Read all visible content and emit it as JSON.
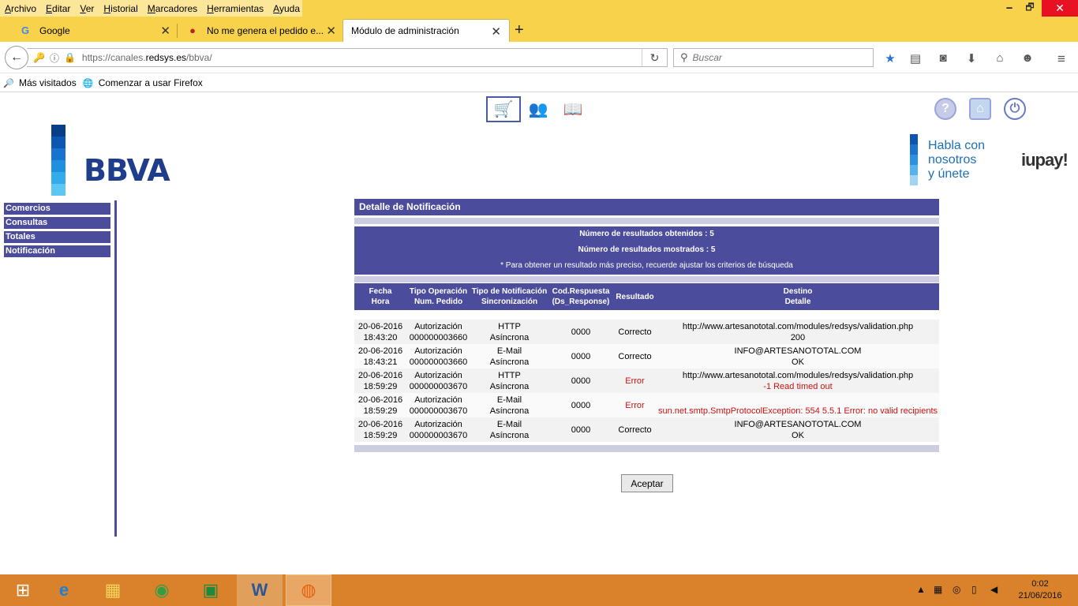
{
  "menubar": {
    "items": [
      "Archivo",
      "Editar",
      "Ver",
      "Historial",
      "Marcadores",
      "Herramientas",
      "Ayuda"
    ],
    "minimize": "🗕",
    "maximize": "🗗",
    "close": "✕"
  },
  "tabs": [
    {
      "title": "Google",
      "icon": "G"
    },
    {
      "title": "No me genera el pedido e...",
      "icon": "●"
    },
    {
      "title": "Módulo de administración",
      "icon": ""
    }
  ],
  "tab_close": "✕",
  "new_tab": "+",
  "nav": {
    "back": "←",
    "url_prefix": "https://canales.",
    "url_domain": "redsys.es",
    "url_path": "/bbva/",
    "reload": "↻",
    "search_placeholder": "Buscar"
  },
  "bookmarks": [
    {
      "label": "Más visitados"
    },
    {
      "label": "Comenzar a usar Firefox"
    }
  ],
  "page": {
    "brand": "BBVA",
    "promo": [
      "Habla con",
      "nosotros",
      "y únete"
    ],
    "promo_brand": "iupay!",
    "left_menu": [
      "Comercios",
      "Consultas",
      "Totales",
      "Notificación"
    ],
    "panel_title": "Detalle de Notificación",
    "results_obtained": "Número de resultados obtenidos : 5",
    "results_shown": "Número de resultados mostrados : 5",
    "note": "* Para obtener un resultado más preciso, recuerde ajustar los criterios de búsqueda",
    "columns": [
      [
        "Fecha",
        "Hora"
      ],
      [
        "Tipo Operación",
        "Num. Pedido"
      ],
      [
        "Tipo de Notificación",
        "Sincronización"
      ],
      [
        "Cod.Respuesta",
        "(Ds_Response)"
      ],
      [
        "Resultado",
        ""
      ],
      [
        "Destino",
        "Detalle"
      ]
    ],
    "rows": [
      {
        "fecha": "20-06-2016",
        "hora": "18:43:20",
        "tipo": "Autorización",
        "pedido": "000000003660",
        "notif": "HTTP",
        "sync": "Asíncrona",
        "cod": "0000",
        "resultado": "Correcto",
        "destino": "http://www.artesanototal.com/modules/redsys/validation.php",
        "detalle": "200",
        "error": false
      },
      {
        "fecha": "20-06-2016",
        "hora": "18:43:21",
        "tipo": "Autorización",
        "pedido": "000000003660",
        "notif": "E-Mail",
        "sync": "Asíncrona",
        "cod": "0000",
        "resultado": "Correcto",
        "destino": "INFO@ARTESANOTOTAL.COM",
        "detalle": "OK",
        "error": false
      },
      {
        "fecha": "20-06-2016",
        "hora": "18:59:29",
        "tipo": "Autorización",
        "pedido": "000000003670",
        "notif": "HTTP",
        "sync": "Asíncrona",
        "cod": "0000",
        "resultado": "Error",
        "destino": "http://www.artesanototal.com/modules/redsys/validation.php",
        "detalle": "-1 Read timed out",
        "error": true
      },
      {
        "fecha": "20-06-2016",
        "hora": "18:59:29",
        "tipo": "Autorización",
        "pedido": "000000003670",
        "notif": "E-Mail",
        "sync": "Asíncrona",
        "cod": "0000",
        "resultado": "Error",
        "destino": "",
        "detalle": "sun.net.smtp.SmtpProtocolException: 554 5.5.1 Error: no valid recipients",
        "error": true
      },
      {
        "fecha": "20-06-2016",
        "hora": "18:59:29",
        "tipo": "Autorización",
        "pedido": "000000003670",
        "notif": "E-Mail",
        "sync": "Asíncrona",
        "cod": "0000",
        "resultado": "Correcto",
        "destino": "INFO@ARTESANOTOTAL.COM",
        "detalle": "OK",
        "error": false
      }
    ],
    "accept_label": "Aceptar"
  },
  "taskbar": {
    "time": "0:02",
    "date": "21/06/2016"
  },
  "colors": {
    "menubar": "#f7d24a",
    "panel": "#4c4c9c",
    "error": "#cc1111",
    "taskbar": "#d9822b"
  }
}
